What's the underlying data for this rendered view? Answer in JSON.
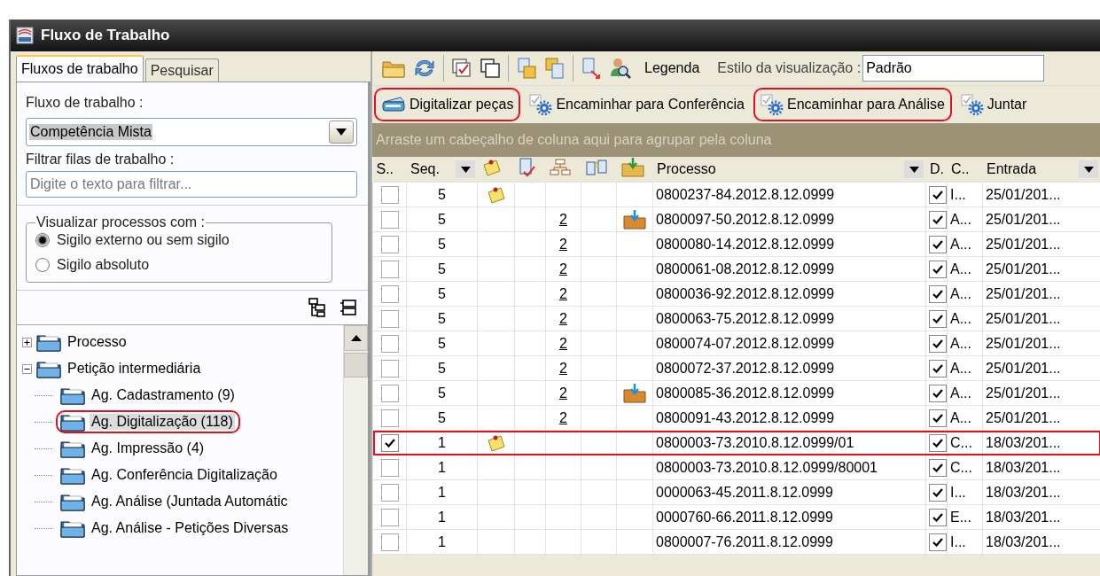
{
  "window": {
    "title": "Fluxo de Trabalho"
  },
  "left_tabs": [
    {
      "label": "Fluxos de trabalho",
      "selected": true
    },
    {
      "label": "Pesquisar",
      "selected": false
    }
  ],
  "workflow": {
    "label": "Fluxo de trabalho :",
    "value": "Competência Mista"
  },
  "filter": {
    "label": "Filtrar filas de trabalho :",
    "placeholder": "Digite o texto para filtrar..."
  },
  "visibility": {
    "legend": "Visualizar processos com :",
    "options": [
      {
        "label": "Sigilo externo ou sem sigilo",
        "selected": true
      },
      {
        "label": "Sigilo absoluto",
        "selected": false
      }
    ]
  },
  "tree": [
    {
      "label": "Processo",
      "expanded": false
    },
    {
      "label": "Petição intermediária",
      "expanded": true,
      "children": [
        {
          "label": "Ag. Cadastramento (9)",
          "selected": false,
          "highlighted": false
        },
        {
          "label": "Ag. Digitalização (118)",
          "selected": true,
          "highlighted": true
        },
        {
          "label": "Ag. Impressão (4)",
          "selected": false,
          "highlighted": false
        },
        {
          "label": "Ag. Conferência Digitalização",
          "selected": false,
          "highlighted": false
        },
        {
          "label": "Ag. Análise (Juntada Automátic",
          "selected": false,
          "highlighted": false
        },
        {
          "label": "Ag. Análise - Petições Diversas",
          "selected": false,
          "highlighted": false
        }
      ]
    }
  ],
  "toolbar": {
    "legend_label": "Legenda",
    "style_label": "Estilo da visualização :",
    "style_value": "Padrão"
  },
  "actions": [
    {
      "label": "Digitalizar peças",
      "kind": "scanner",
      "highlighted": true
    },
    {
      "label": "Encaminhar para Conferência",
      "kind": "gear",
      "highlighted": false
    },
    {
      "label": "Encaminhar para Análise",
      "kind": "gear",
      "highlighted": true
    },
    {
      "label": "Juntar",
      "kind": "gear",
      "highlighted": false
    }
  ],
  "group_hint": "Arraste um cabeçalho de coluna aqui para agrupar pela coluna",
  "table": {
    "columns": [
      {
        "kind": "text",
        "label": "S..",
        "dropdown": false
      },
      {
        "kind": "text",
        "label": "Seq.",
        "dropdown": true
      },
      {
        "kind": "note"
      },
      {
        "kind": "doc-check"
      },
      {
        "kind": "hierarchy"
      },
      {
        "kind": "compare"
      },
      {
        "kind": "folder"
      },
      {
        "kind": "text",
        "label": "Processo",
        "dropdown": true
      },
      {
        "kind": "text",
        "label": "D.",
        "dropdown": false
      },
      {
        "kind": "text",
        "label": "C..",
        "dropdown": false
      },
      {
        "kind": "text",
        "label": "Entrada",
        "dropdown": true
      }
    ],
    "rows": [
      {
        "checked": false,
        "seq": "5",
        "note": true,
        "link": null,
        "folder": false,
        "process": "0800237-84.2012.8.12.0999",
        "d_checked": true,
        "c": "I...",
        "entrada": "25/01/201...",
        "highlighted": false
      },
      {
        "checked": false,
        "seq": "5",
        "note": false,
        "link": "2",
        "folder": true,
        "process": "0800097-50.2012.8.12.0999",
        "d_checked": true,
        "c": "A...",
        "entrada": "25/01/201...",
        "highlighted": false
      },
      {
        "checked": false,
        "seq": "5",
        "note": false,
        "link": "2",
        "folder": false,
        "process": "0800080-14.2012.8.12.0999",
        "d_checked": true,
        "c": "A...",
        "entrada": "25/01/201...",
        "highlighted": false
      },
      {
        "checked": false,
        "seq": "5",
        "note": false,
        "link": "2",
        "folder": false,
        "process": "0800061-08.2012.8.12.0999",
        "d_checked": true,
        "c": "A...",
        "entrada": "25/01/201...",
        "highlighted": false
      },
      {
        "checked": false,
        "seq": "5",
        "note": false,
        "link": "2",
        "folder": false,
        "process": "0800036-92.2012.8.12.0999",
        "d_checked": true,
        "c": "A...",
        "entrada": "25/01/201...",
        "highlighted": false
      },
      {
        "checked": false,
        "seq": "5",
        "note": false,
        "link": "2",
        "folder": false,
        "process": "0800063-75.2012.8.12.0999",
        "d_checked": true,
        "c": "A...",
        "entrada": "25/01/201...",
        "highlighted": false
      },
      {
        "checked": false,
        "seq": "5",
        "note": false,
        "link": "2",
        "folder": false,
        "process": "0800074-07.2012.8.12.0999",
        "d_checked": true,
        "c": "A...",
        "entrada": "25/01/201...",
        "highlighted": false
      },
      {
        "checked": false,
        "seq": "5",
        "note": false,
        "link": "2",
        "folder": false,
        "process": "0800072-37.2012.8.12.0999",
        "d_checked": true,
        "c": "A...",
        "entrada": "25/01/201...",
        "highlighted": false
      },
      {
        "checked": false,
        "seq": "5",
        "note": false,
        "link": "2",
        "folder": true,
        "process": "0800085-36.2012.8.12.0999",
        "d_checked": true,
        "c": "A...",
        "entrada": "25/01/201...",
        "highlighted": false
      },
      {
        "checked": false,
        "seq": "5",
        "note": false,
        "link": "2",
        "folder": false,
        "process": "0800091-43.2012.8.12.0999",
        "d_checked": true,
        "c": "A...",
        "entrada": "25/01/201...",
        "highlighted": false
      },
      {
        "checked": true,
        "seq": "1",
        "note": true,
        "link": null,
        "folder": false,
        "process": "0800003-73.2010.8.12.0999/01",
        "d_checked": true,
        "c": "C...",
        "entrada": "18/03/201...",
        "highlighted": true
      },
      {
        "checked": false,
        "seq": "1",
        "note": false,
        "link": null,
        "folder": false,
        "process": "0800003-73.2010.8.12.0999/80001",
        "d_checked": true,
        "c": "C...",
        "entrada": "18/03/201...",
        "highlighted": false
      },
      {
        "checked": false,
        "seq": "1",
        "note": false,
        "link": null,
        "folder": false,
        "process": "0000063-45.2011.8.12.0999",
        "d_checked": true,
        "c": "I...",
        "entrada": "18/03/201...",
        "highlighted": false
      },
      {
        "checked": false,
        "seq": "1",
        "note": false,
        "link": null,
        "folder": false,
        "process": "0000760-66.2011.8.12.0999",
        "d_checked": true,
        "c": "E...",
        "entrada": "18/03/201...",
        "highlighted": false
      },
      {
        "checked": false,
        "seq": "1",
        "note": false,
        "link": null,
        "folder": false,
        "process": "0800007-76.2011.8.12.0999",
        "d_checked": true,
        "c": "I...",
        "entrada": "18/03/201...",
        "highlighted": false
      }
    ]
  }
}
